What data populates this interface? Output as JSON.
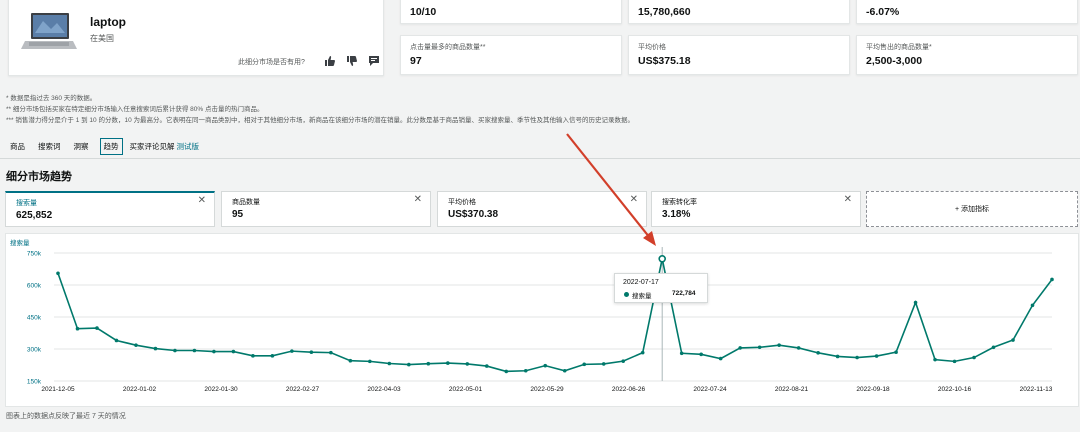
{
  "product": {
    "name": "laptop",
    "region": "在美国",
    "usefulness_question": "此细分市场是否有用?"
  },
  "metrics_row1": [
    {
      "value": "10/10"
    },
    {
      "value": "15,780,660"
    },
    {
      "value": "-6.07%"
    }
  ],
  "metrics_row2": [
    {
      "label": "点击量最多的商品数量**",
      "value": "97"
    },
    {
      "label": "平均价格",
      "value": "US$375.18"
    },
    {
      "label": "平均售出的商品数量*",
      "value": "2,500-3,000"
    }
  ],
  "notes": [
    "* 数据是指过去 360 天的数据。",
    "** 细分市场包括买家在特定细分市场输入任意搜索词后累计获得 80% 点击量的热门商品。",
    "*** 销售潜力得分是介于 1 到 10 的分数，10 为最高分。它表明在同一商品类别中，相对于其他细分市场，新商品在该细分市场的潜在销量。此分数是基于商品销量、买家搜索量、季节性及其他输入信号的历史记录数据。"
  ],
  "tabs": [
    {
      "label": "商品"
    },
    {
      "label": "搜索词"
    },
    {
      "label": "洞察"
    },
    {
      "label": "趋势",
      "active": true
    },
    {
      "label": "买家评论见解",
      "beta": "测试版"
    }
  ],
  "section_title": "细分市场趋势",
  "selector_cards": [
    {
      "label": "搜索量",
      "value": "625,852",
      "active": true
    },
    {
      "label": "商品数量",
      "value": "95"
    },
    {
      "label": "平均价格",
      "value": "US$370.38"
    },
    {
      "label": "搜索转化率",
      "value": "3.18%"
    }
  ],
  "add_metric_label": "+ 添加指标",
  "tooltip": {
    "date": "2022-07-17",
    "series": "搜索量",
    "value": "722,784"
  },
  "footnote": "图表上的数据点反映了最近 7 天的情况",
  "colors": {
    "accent": "#007185",
    "line": "#00796b",
    "arrow": "#d23f2a"
  },
  "chart_data": {
    "type": "line",
    "ylabel": "搜索量",
    "ylim": [
      150000,
      750000
    ],
    "y_ticks": [
      "150k",
      "300k",
      "450k",
      "600k",
      "750k"
    ],
    "x_tick_labels": [
      "2021-12-05",
      "2022-01-02",
      "2022-01-30",
      "2022-02-27",
      "2022-04-03",
      "2022-05-01",
      "2022-05-29",
      "2022-06-26",
      "2022-07-24",
      "2022-08-21",
      "2022-09-18",
      "2022-10-16",
      "2022-11-13"
    ],
    "series": [
      {
        "name": "搜索量",
        "values": [
          655000,
          395000,
          398000,
          340000,
          318000,
          302000,
          293000,
          293000,
          288000,
          288000,
          268000,
          268000,
          290000,
          285000,
          283000,
          245000,
          242000,
          232000,
          227000,
          231000,
          234000,
          230000,
          220000,
          195000,
          198000,
          222000,
          198000,
          228000,
          230000,
          243000,
          283000,
          722784,
          280000,
          275000,
          255000,
          305000,
          308000,
          318000,
          305000,
          282000,
          265000,
          260000,
          267000,
          285000,
          518000,
          250000,
          242000,
          260000,
          308000,
          342000,
          505000,
          625852
        ]
      }
    ]
  }
}
